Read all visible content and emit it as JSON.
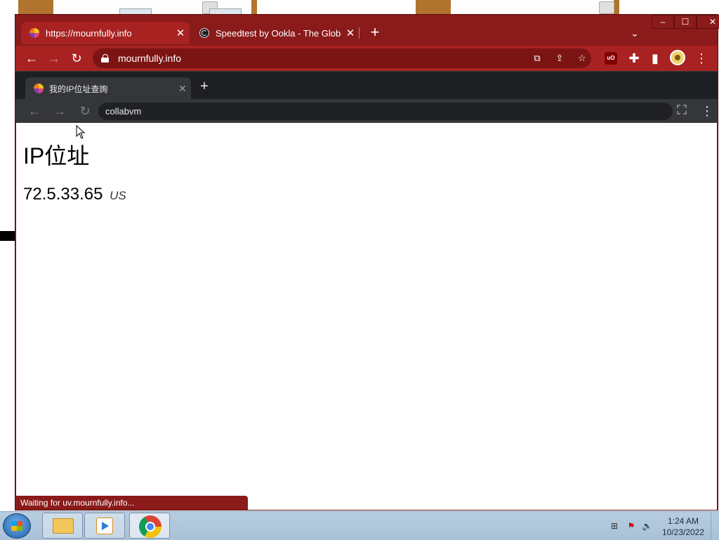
{
  "browser": {
    "tabs": [
      {
        "title": "https://mournfully.info",
        "active": true
      },
      {
        "title": "Speedtest by Ookla - The Global",
        "active": false
      }
    ],
    "address": "mournfully.info",
    "status_text": "Waiting for uv.mournfully.info...",
    "theme_color": "#a82222"
  },
  "inner": {
    "tab_title": "我的IP位址查詢",
    "address": "collabvm",
    "page": {
      "heading": "IP位址",
      "ip": "72.5.33.65",
      "country": "US"
    }
  },
  "taskbar": {
    "time": "1:24 AM",
    "date": "10/23/2022"
  }
}
